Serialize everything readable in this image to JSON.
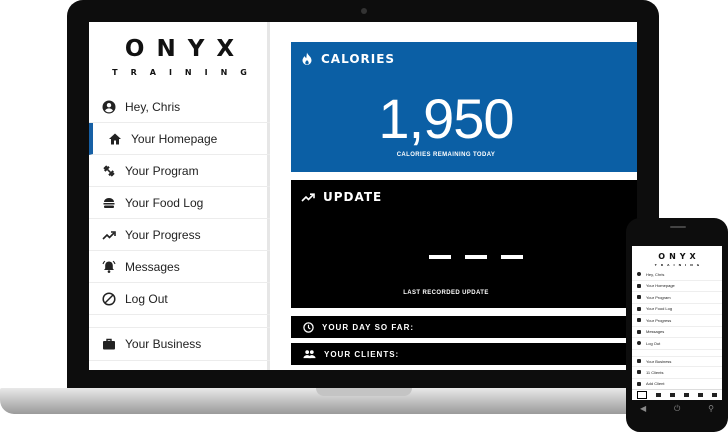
{
  "brand": {
    "name": "ONYX",
    "tagline": "TRAINING"
  },
  "sidebar": {
    "items": [
      {
        "label": "Hey, Chris",
        "icon": "account-circle-icon"
      },
      {
        "label": "Your Homepage",
        "icon": "home-icon",
        "active": true
      },
      {
        "label": "Your Program",
        "icon": "dumbbell-icon"
      },
      {
        "label": "Your Food Log",
        "icon": "burger-icon"
      },
      {
        "label": "Your Progress",
        "icon": "trending-up-icon"
      },
      {
        "label": "Messages",
        "icon": "bell-icon"
      },
      {
        "label": "Log Out",
        "icon": "block-icon"
      },
      {
        "label": "Your Business",
        "icon": "briefcase-icon"
      }
    ]
  },
  "main": {
    "calories": {
      "title": "CALORIES",
      "value": "1,950",
      "subtitle": "CALORIES REMAINING TODAY",
      "icon": "flame-icon",
      "color": "#0b5fa5"
    },
    "update": {
      "title": "UPDATE",
      "value": "- - -",
      "subtitle": "LAST RECORDED UPDATE",
      "icon": "trending-up-icon"
    },
    "day": {
      "label": "YOUR DAY SO FAR:",
      "icon": "clock-icon"
    },
    "clients": {
      "label": "YOUR CLIENTS:",
      "icon": "people-icon"
    }
  },
  "phone": {
    "items": [
      "Hey, Chris",
      "Your Homepage",
      "Your Program",
      "Your Food Log",
      "Your Progress",
      "Messages",
      "Log Out",
      "Your Business",
      "11 Clients",
      "Add Client"
    ]
  }
}
